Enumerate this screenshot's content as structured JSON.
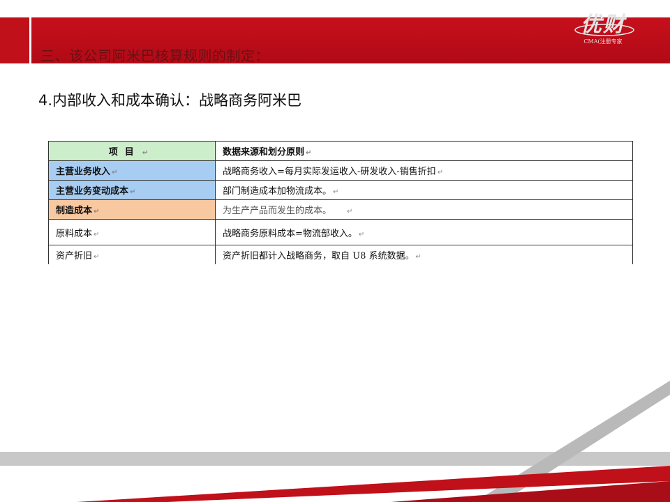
{
  "header": {
    "section_title": "三、该公司阿米巴核算规则的制定：",
    "logo_text": "优财",
    "logo_sub": "CMA(注册专家"
  },
  "subtitle": "4.内部收入和成本确认：战略商务阿米巴",
  "table": {
    "columns": [
      "项目",
      "数据来源和划分原则"
    ],
    "rows": [
      {
        "item": "主营业务收入",
        "rule": "战略商务收入=每月实际发运收入-研发收入-销售折扣",
        "style": "blue"
      },
      {
        "item": "主营业务变动成本",
        "rule": "部门制造成本加物流成本。",
        "style": "blue"
      },
      {
        "item": "制造成本",
        "rule": "为生产产品而发生的成本。",
        "style": "orange"
      },
      {
        "item": "原料成本",
        "rule": "战略商务原料成本=物流部收入。",
        "style": "plain"
      },
      {
        "item": "资产折旧",
        "rule": "资产折旧都计入战略商务，取自 U8 系统数据。",
        "style": "plain"
      }
    ]
  },
  "colors": {
    "header_red": "#c6101c",
    "head_green": "#cdeecb",
    "cell_blue": "#a8cdf2",
    "cell_orange": "#f8c8a0",
    "stripe_gray": "#c8c8c8"
  }
}
